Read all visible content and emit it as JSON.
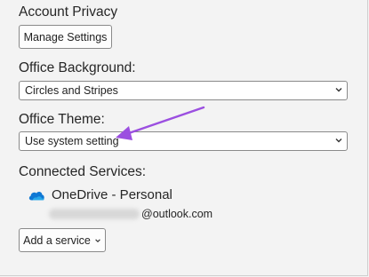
{
  "account_privacy": {
    "title": "Account Privacy",
    "manage_button": "Manage Settings"
  },
  "office_background": {
    "title": "Office Background:",
    "selected": "Circles and Stripes"
  },
  "office_theme": {
    "title": "Office Theme:",
    "selected": "Use system setting"
  },
  "connected_services": {
    "title": "Connected Services:",
    "services": [
      {
        "icon": "onedrive-cloud-icon",
        "name": "OneDrive - Personal",
        "email_domain": "@outlook.com"
      }
    ],
    "add_button": "Add a service"
  },
  "colors": {
    "annotation_arrow": "#9b4fe0",
    "onedrive_blue": "#0f78d4"
  }
}
